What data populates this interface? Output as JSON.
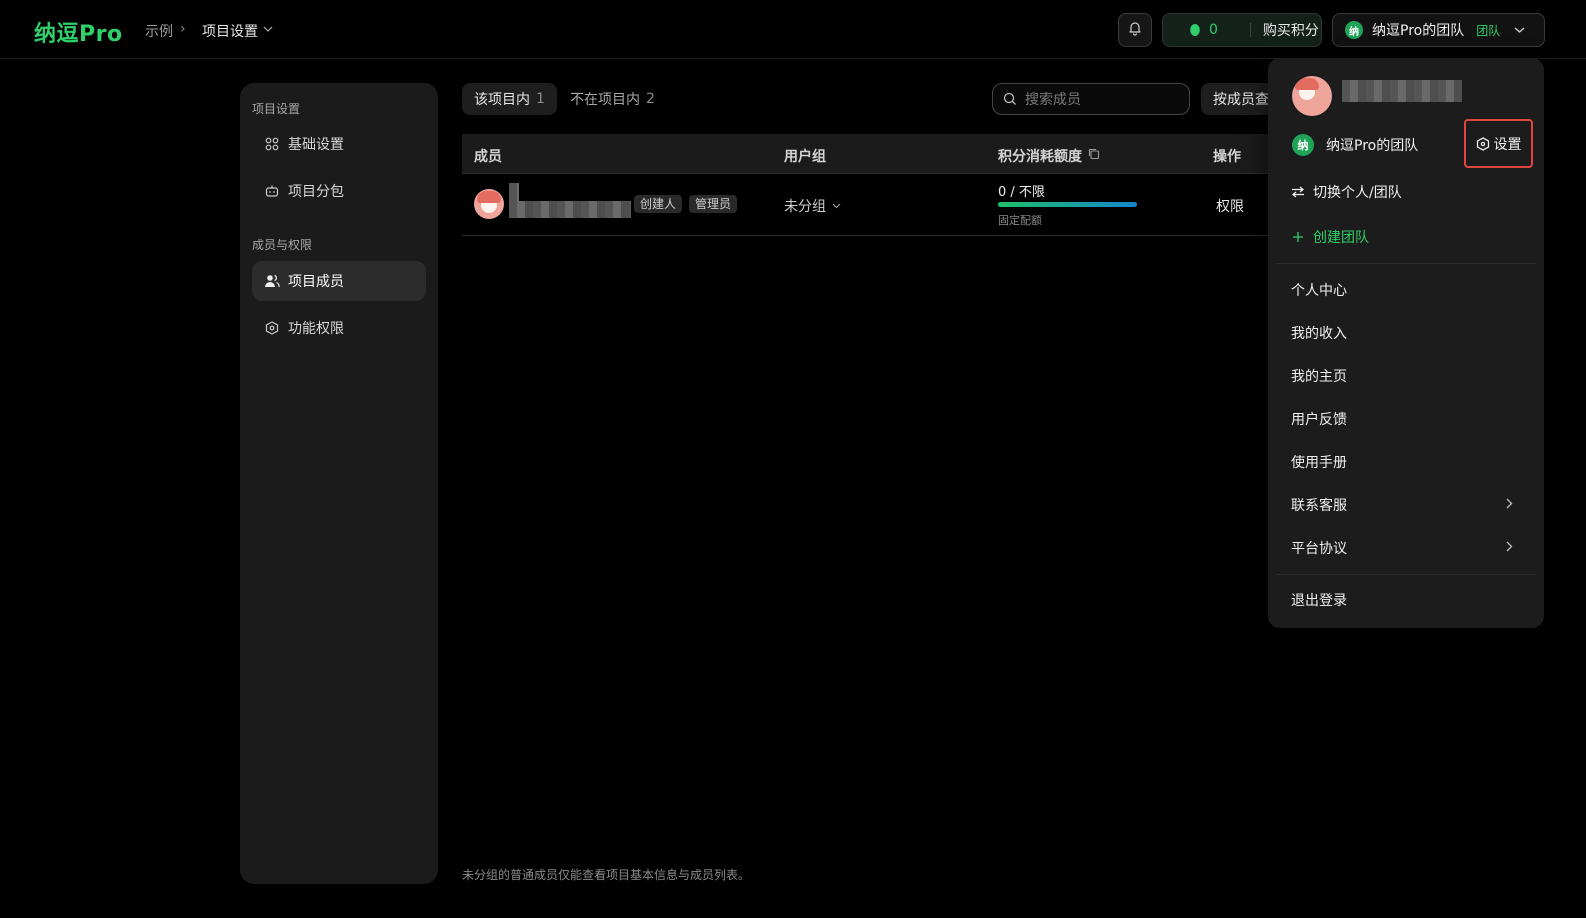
{
  "header": {
    "logo": "纳逗Pro",
    "breadcrumb": {
      "root": "示例",
      "separator": "›",
      "current": "项目设置"
    },
    "points": {
      "value": "0",
      "buy_label": "购买积分"
    },
    "team": {
      "avatar_text": "纳",
      "name": "纳逗Pro的团队",
      "badge": "团队"
    }
  },
  "sidebar": {
    "section1": "项目设置",
    "items1": [
      {
        "label": "基础设置",
        "icon": "grid-icon"
      },
      {
        "label": "项目分包",
        "icon": "robot-icon"
      }
    ],
    "section2": "成员与权限",
    "items2": [
      {
        "label": "项目成员",
        "icon": "users-icon",
        "active": true
      },
      {
        "label": "功能权限",
        "icon": "hexagon-icon"
      }
    ]
  },
  "main": {
    "tabs": [
      {
        "label": "该项目内",
        "count": "1"
      },
      {
        "label": "不在项目内",
        "count": "2"
      }
    ],
    "search_placeholder": "搜索成员",
    "by_member_label": "按成员查",
    "columns": [
      "成员",
      "用户组",
      "积分消耗额度",
      "操作"
    ],
    "rows": [
      {
        "tags": [
          "创建人",
          "管理员"
        ],
        "group": "未分组",
        "quota": "0 / 不限",
        "quota_note": "固定配额",
        "quota_used_fraction": 1.0,
        "action": "权限"
      }
    ],
    "footnote": "未分组的普通成员仅能查看项目基本信息与成员列表。"
  },
  "menu": {
    "team_avatar_text": "纳",
    "team_name": "纳逗Pro的团队",
    "settings_label": "设置",
    "switch_label": "切换个人/团队",
    "create_team_label": "创建团队",
    "items": [
      "个人中心",
      "我的收入",
      "我的主页",
      "用户反馈",
      "使用手册",
      "联系客服",
      "平台协议"
    ],
    "logout_label": "退出登录"
  },
  "colors": {
    "brand_green": "#2fd06a",
    "highlight_red": "#e0453e",
    "background": "#000000",
    "panel": "#1b1b1b"
  }
}
